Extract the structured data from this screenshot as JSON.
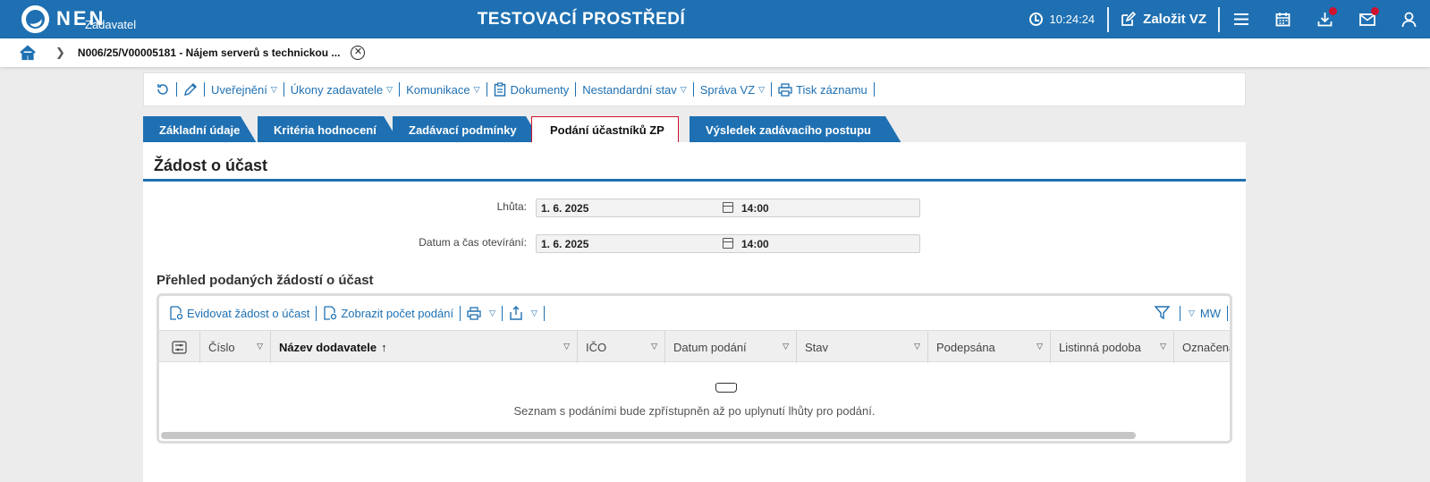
{
  "header": {
    "logo_text": "NEN",
    "logo_sub": "Zadavatel",
    "env_title": "TESTOVACÍ PROSTŘEDÍ",
    "clock": "10:24:24",
    "create_label": "Založit VZ",
    "icons": [
      "menu-icon",
      "calendar-icon",
      "download-icon",
      "mail-icon",
      "user-icon"
    ],
    "accent": "#1e70b2",
    "badge_color": "#d0122e"
  },
  "breadcrumb": {
    "item": "N006/25/V00005181 - Nájem serverů s technickou ..."
  },
  "actions": [
    {
      "label": "Uveřejnění",
      "dropdown": true
    },
    {
      "label": "Úkony zadavatele",
      "dropdown": true
    },
    {
      "label": "Komunikace",
      "dropdown": true
    },
    {
      "label": "Dokumenty",
      "dropdown": false
    },
    {
      "label": "Nestandardní stav",
      "dropdown": true
    },
    {
      "label": "Správa VZ",
      "dropdown": true
    },
    {
      "label": "Tisk záznamu",
      "dropdown": false
    }
  ],
  "tabs": [
    {
      "label": "Základní údaje",
      "active": false
    },
    {
      "label": "Kritéria hodnocení",
      "active": false
    },
    {
      "label": "Zadávací podmínky",
      "active": false
    },
    {
      "label": "Podání účastníků ZP",
      "active": true
    },
    {
      "label": "Výsledek zadávacího postupu",
      "active": false
    }
  ],
  "panel": {
    "title": "Žádost o účast",
    "fields": [
      {
        "label": "Lhůta:",
        "date": "1. 6. 2025",
        "time": "14:00"
      },
      {
        "label": "Datum a čas otevírání:",
        "date": "1. 6. 2025",
        "time": "14:00"
      }
    ],
    "section_title": "Přehled podaných žádostí o účast"
  },
  "grid": {
    "tools": {
      "register": "Evidovat žádost o účast",
      "show_count": "Zobrazit počet podání",
      "view_label": "MW"
    },
    "columns": [
      "Číslo",
      "Název dodavatele",
      "IČO",
      "Datum podání",
      "Stav",
      "Podepsána",
      "Listinná podoba",
      "Označena"
    ],
    "empty_message": "Seznam s podáními bude zpřístupněn až po uplynutí lhůty pro podání."
  }
}
